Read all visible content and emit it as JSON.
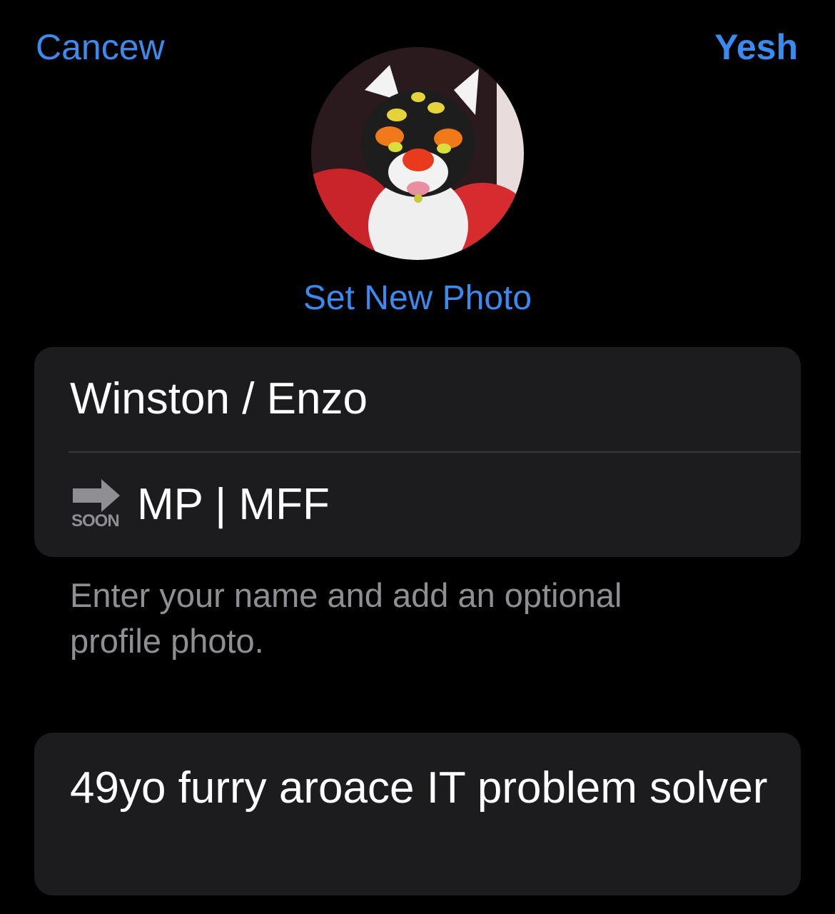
{
  "header": {
    "cancel_label": "Cancew",
    "done_label": "Yesh"
  },
  "profile": {
    "avatar_icon": "profile-photo",
    "set_photo_label": "Set New Photo"
  },
  "fields": {
    "first_name": "Winston / Enzo",
    "last_name_emoji": "soon-arrow",
    "soon_label": "SOON",
    "last_name": "MP | MFF"
  },
  "hint": "Enter your name and add an optional profile photo.",
  "bio": "49yo furry aroace IT problem solver",
  "colors": {
    "background": "#000000",
    "card": "#1c1c1e",
    "accent": "#3b8af0",
    "secondary_text": "#8e8e93",
    "divider": "#38383a"
  }
}
